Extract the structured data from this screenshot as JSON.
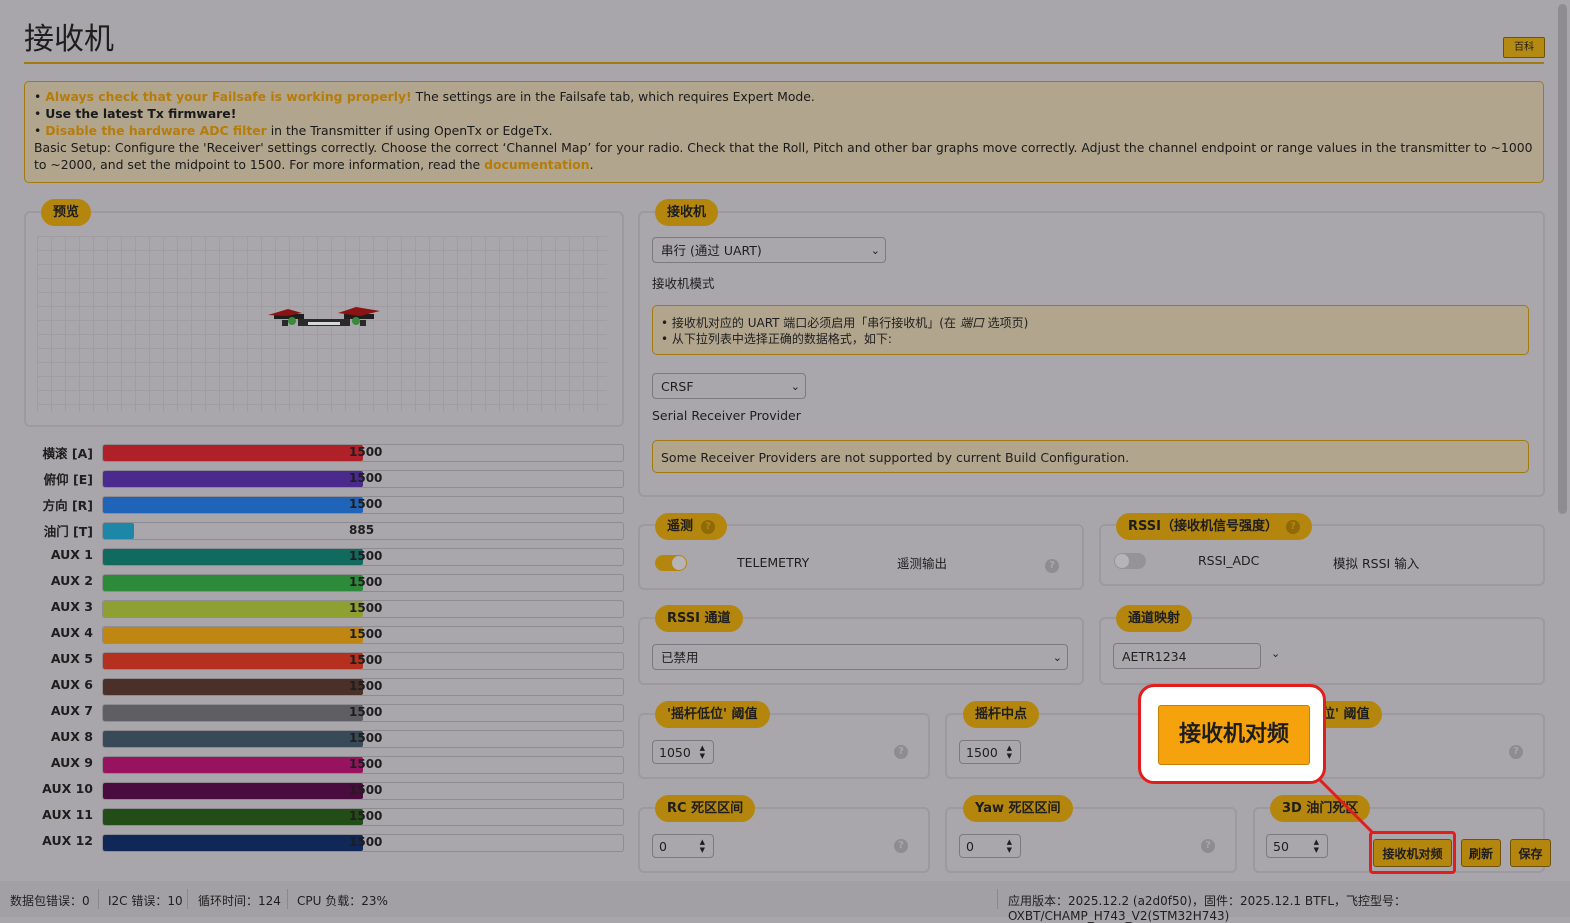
{
  "page": {
    "title": "接收机",
    "wiki_label": "百科"
  },
  "notice": {
    "line1_highlight": "Always check that your Failsafe is working properly!",
    "line1_rest": " The settings are in the Failsafe tab, which requires Expert Mode.",
    "line2": "Use the latest Tx firmware!",
    "line3_highlight": "Disable the hardware ADC filter",
    "line3_rest": " in the Transmitter if using OpenTx or EdgeTx.",
    "line4": "Basic Setup: Configure the 'Receiver' settings correctly. Choose the correct ‘Channel Map’ for your radio. Check that the Roll, Pitch and other bar graphs move correctly. Adjust the channel endpoint or range values in the transmitter to ~1000 to ~2000, and set the midpoint to 1500. For more information, read the ",
    "link": "documentation",
    "tail": "."
  },
  "preview": {
    "tag": "预览"
  },
  "channels": [
    {
      "label": "横滚 [A]",
      "value": "1500",
      "fraction": 0.5,
      "color": "#b02029"
    },
    {
      "label": "俯仰 [E]",
      "value": "1500",
      "fraction": 0.5,
      "color": "#4a2a8c"
    },
    {
      "label": "方向 [R]",
      "value": "1500",
      "fraction": 0.5,
      "color": "#1f64b8"
    },
    {
      "label": "油门 [T]",
      "value": "885",
      "fraction": 0.06,
      "color": "#1e86a6"
    },
    {
      "label": "AUX 1",
      "value": "1500",
      "fraction": 0.5,
      "color": "#106a5e"
    },
    {
      "label": "AUX 2",
      "value": "1500",
      "fraction": 0.5,
      "color": "#2d8a3a"
    },
    {
      "label": "AUX 3",
      "value": "1500",
      "fraction": 0.5,
      "color": "#8fa032"
    },
    {
      "label": "AUX 4",
      "value": "1500",
      "fraction": 0.5,
      "color": "#bf8712"
    },
    {
      "label": "AUX 5",
      "value": "1500",
      "fraction": 0.5,
      "color": "#b5301e"
    },
    {
      "label": "AUX 6",
      "value": "1500",
      "fraction": 0.5,
      "color": "#4a3028"
    },
    {
      "label": "AUX 7",
      "value": "1500",
      "fraction": 0.5,
      "color": "#5f5e62"
    },
    {
      "label": "AUX 8",
      "value": "1500",
      "fraction": 0.5,
      "color": "#384a58"
    },
    {
      "label": "AUX 9",
      "value": "1500",
      "fraction": 0.5,
      "color": "#98135f"
    },
    {
      "label": "AUX 10",
      "value": "1500",
      "fraction": 0.5,
      "color": "#4a0c3e"
    },
    {
      "label": "AUX 11",
      "value": "1500",
      "fraction": 0.5,
      "color": "#234d16"
    },
    {
      "label": "AUX 12",
      "value": "1500",
      "fraction": 0.5,
      "color": "#102858"
    }
  ],
  "receiver": {
    "tag": "接收机",
    "mode_value": "串行 (通过 UART)",
    "mode_label": "接收机模式",
    "note_line1": "• 接收机对应的 UART 端口必须启用「串行接收机」(在 ",
    "note_line1_em": "端口",
    "note_line1_tail": " 选项页)",
    "note_line2": "• 从下拉列表中选择正确的数据格式，如下:",
    "provider_value": "CRSF",
    "provider_label": "Serial Receiver Provider",
    "provider_warning": "Some Receiver Providers are not supported by current Build Configuration."
  },
  "telemetry": {
    "tag": "遥测",
    "toggle_label": "TELEMETRY",
    "desc": "遥测输出",
    "enabled": true
  },
  "rssi": {
    "tag": "RSSI（接收机信号强度）",
    "toggle_label": "RSSI_ADC",
    "desc": "模拟 RSSI 输入",
    "enabled": false
  },
  "rssi_channel": {
    "tag": "RSSI 通道",
    "value": "已禁用"
  },
  "channel_map": {
    "tag": "通道映射",
    "value": "AETR1234"
  },
  "stick_low": {
    "tag": "'摇杆低位' 阈值",
    "value": "1050"
  },
  "stick_center": {
    "tag": "摇杆中点",
    "value": "1500"
  },
  "stick_high": {
    "tag": "位' 阈值"
  },
  "rc_deadband": {
    "tag": "RC 死区区间",
    "value": "0"
  },
  "yaw_deadband": {
    "tag": "Yaw 死区区间",
    "value": "0"
  },
  "throttle_deadband": {
    "tag": "3D 油门死区",
    "value": "50"
  },
  "buttons": {
    "bind": "接收机对频",
    "refresh": "刷新",
    "save": "保存"
  },
  "callout": {
    "label": "接收机对频"
  },
  "status": {
    "packet_error": "数据包错误：0",
    "i2c_error": "I2C 错误：10",
    "cycle_time": "循环时间：124",
    "cpu_load": "CPU 负载：23%",
    "version": "应用版本：2025.12.2 (a2d0f50)，固件：2025.12.1 BTFL，飞控型号：OXBT/CHAMP_H743_V2(STM32H743)"
  },
  "colors": {
    "accent": "#b5860d",
    "highlight_red": "#e11d1d",
    "callout_button": "#f6a20c"
  }
}
